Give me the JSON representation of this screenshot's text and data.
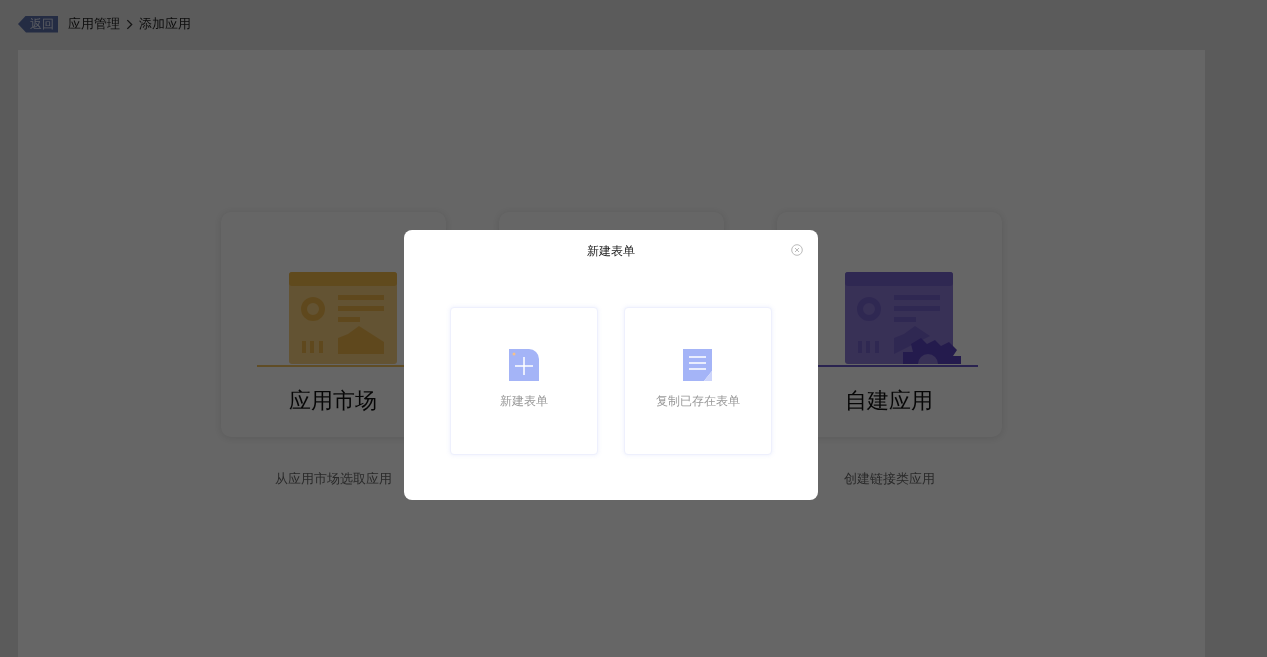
{
  "header": {
    "back_button": "返回",
    "breadcrumb": [
      {
        "label": "应用管理"
      },
      {
        "label": "添加应用"
      }
    ]
  },
  "cards": [
    {
      "kind": "market",
      "title": "应用市场",
      "description": "从应用市场选取应用"
    },
    {
      "kind": "blank"
    },
    {
      "kind": "custom",
      "title": "自建应用",
      "description": "创建链接类应用"
    }
  ],
  "dialog": {
    "title": "新建表单",
    "options": [
      {
        "kind": "new",
        "label": "新建表单"
      },
      {
        "kind": "copy",
        "label": "复制已存在表单"
      }
    ]
  }
}
